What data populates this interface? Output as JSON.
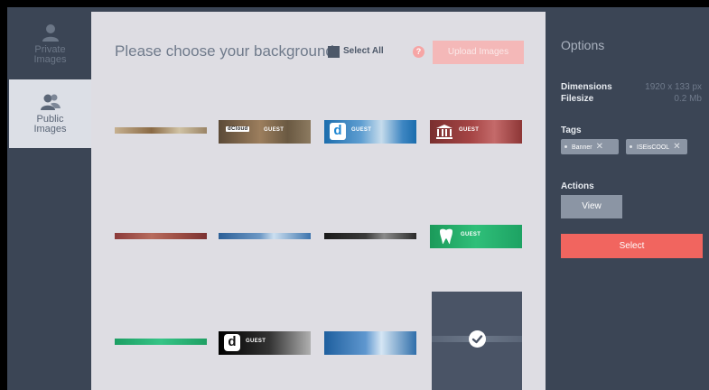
{
  "sidebar": {
    "tabs": [
      {
        "label_line1": "Private",
        "label_line2": "Images",
        "icon": "user-icon",
        "active": false
      },
      {
        "label_line1": "Public",
        "label_line2": "Images",
        "icon": "users-icon",
        "active": true
      }
    ]
  },
  "main": {
    "heading": "Please choose your background",
    "select_all_label": "Select All",
    "help_icon": "?",
    "upload_label": "Upload Images",
    "thumbnails": [
      {
        "caption": ""
      },
      {
        "caption": "GUEST",
        "brand": "dCloud"
      },
      {
        "caption": "GUEST",
        "badge": "d"
      },
      {
        "caption": "GUEST"
      },
      {
        "caption": ""
      },
      {
        "caption": ""
      },
      {
        "caption": ""
      },
      {
        "caption": "GUEST"
      },
      {
        "caption": ""
      },
      {
        "caption": "GUEST",
        "badge": "d"
      },
      {
        "caption": ""
      }
    ],
    "selected_index": 11
  },
  "options": {
    "title": "Options",
    "dimensions_label": "Dimensions",
    "dimensions_value": "1920 x 133 px",
    "filesize_label": "Filesize",
    "filesize_value": "0.2 Mb",
    "tags_label": "Tags",
    "tags": [
      {
        "label": "Banner"
      },
      {
        "label": "ISEisCOOL"
      }
    ],
    "actions_label": "Actions",
    "view_label": "View",
    "select_label": "Select"
  },
  "colors": {
    "panel": "#3b4555",
    "content": "#dedde3",
    "accent": "#f1655f",
    "tag": "#8b95a4"
  }
}
